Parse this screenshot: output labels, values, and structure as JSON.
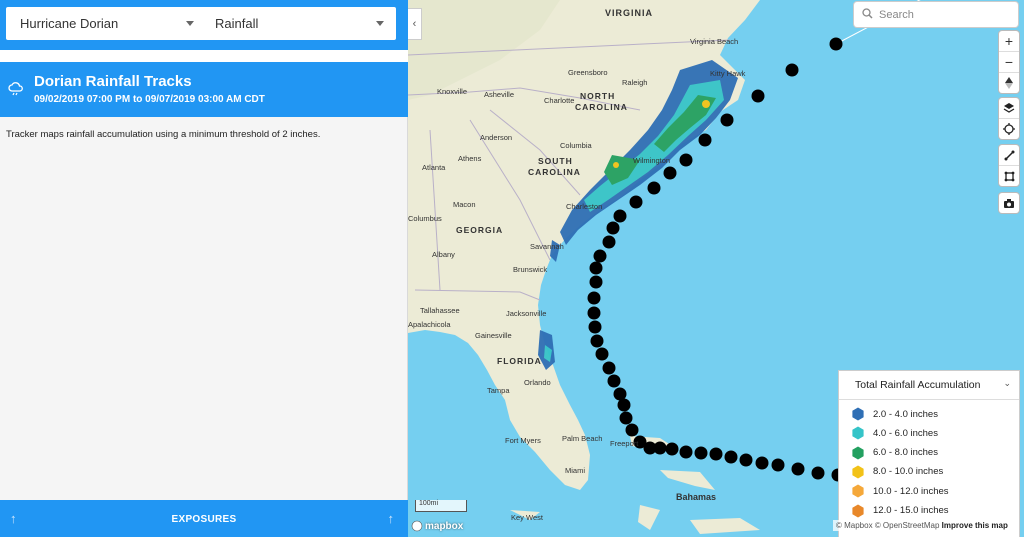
{
  "filters": {
    "event": "Hurricane Dorian",
    "layer": "Rainfall"
  },
  "track": {
    "title": "Dorian Rainfall Tracks",
    "dates": "09/02/2019 07:00 PM to 09/07/2019 03:00 AM CDT",
    "description": "Tracker maps rainfall accumulation using a minimum threshold of 2 inches.",
    "icon": "rain-cloud-icon"
  },
  "footer": {
    "exposures_label": "EXPOSURES"
  },
  "search": {
    "placeholder": "Search"
  },
  "map_controls": {
    "zoom_in": "+",
    "zoom_out": "−"
  },
  "map_labels": {
    "states": [
      "VIRGINIA",
      "NORTH CAROLINA",
      "SOUTH CAROLINA",
      "GEORGIA",
      "FLORIDA"
    ],
    "cities": [
      "Virginia Beach",
      "Kitty Hawk",
      "Greensboro",
      "Raleigh",
      "Knoxville",
      "Asheville",
      "Charlotte",
      "Anderson",
      "Athens",
      "Atlanta",
      "Columbia",
      "Wilmington",
      "Macon",
      "Charleston",
      "Columbus",
      "Savannah",
      "Albany",
      "Brunswick",
      "Tallahassee",
      "Jacksonville",
      "Apalachicola",
      "Gainesville",
      "Orlando",
      "Tampa",
      "Fort Myers",
      "Palm Beach",
      "Miami",
      "Freeport",
      "Key West"
    ],
    "bahamas": "Bahamas"
  },
  "legend": {
    "title": "Total Rainfall Accumulation",
    "items": [
      {
        "label": "2.0 - 4.0 inches",
        "color": "#2f6fb5"
      },
      {
        "label": "4.0 - 6.0 inches",
        "color": "#35c4c8"
      },
      {
        "label": "6.0 - 8.0 inches",
        "color": "#23a060"
      },
      {
        "label": "8.0 - 10.0 inches",
        "color": "#f2c218"
      },
      {
        "label": "10.0 - 12.0 inches",
        "color": "#f5a83a"
      },
      {
        "label": "12.0 - 15.0 inches",
        "color": "#e8882a"
      }
    ]
  },
  "scale": "100mi",
  "attribution": {
    "mapbox": "© Mapbox",
    "osm": "© OpenStreetMap",
    "improve": "Improve this map"
  },
  "logo": "mapbox",
  "colors": {
    "accent": "#2196f3",
    "water": "#75cff0",
    "land": "#ecebd6",
    "track": "#000000"
  }
}
